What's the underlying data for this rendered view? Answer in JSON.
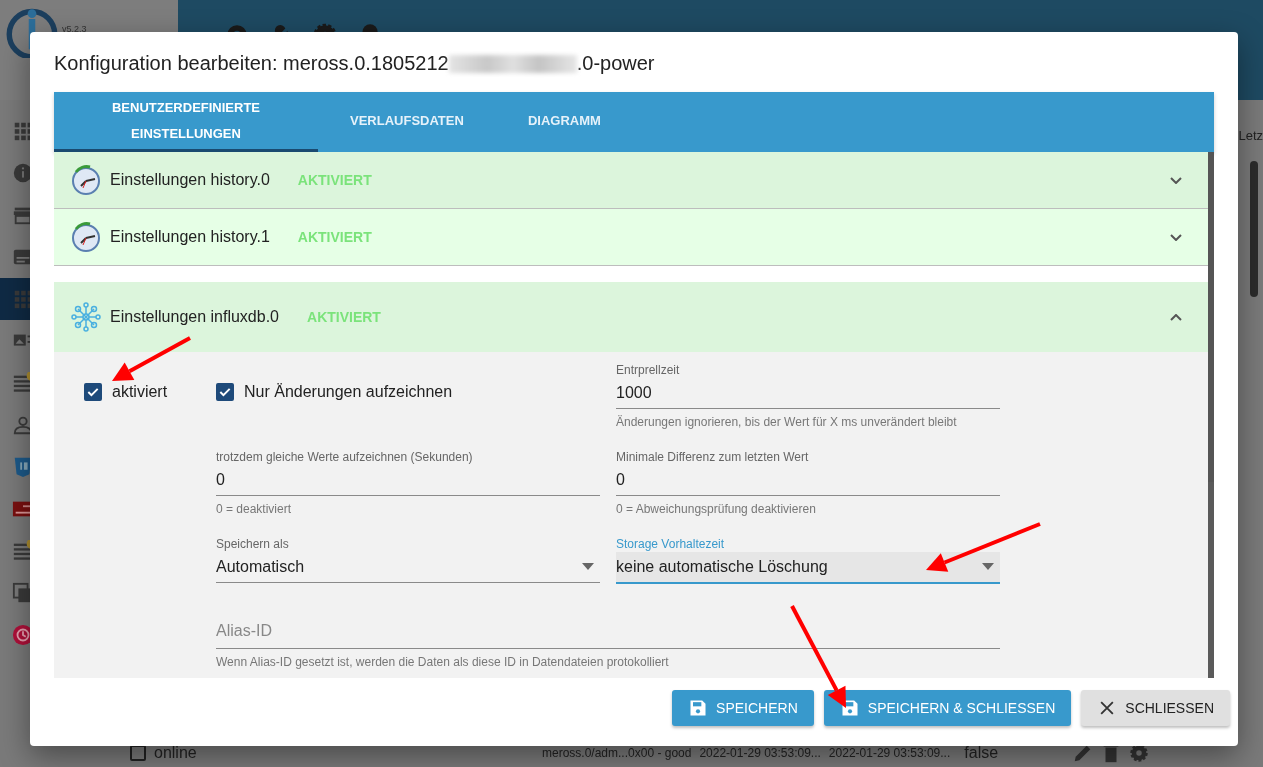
{
  "app": {
    "version": "v5.2.3",
    "header_text": "Letz",
    "sidebar": [
      {
        "kind": "grid",
        "selected": false
      },
      {
        "kind": "info",
        "selected": false
      },
      {
        "kind": "store",
        "selected": false
      },
      {
        "kind": "card",
        "selected": false
      },
      {
        "kind": "grid",
        "selected": true
      },
      {
        "kind": "image",
        "selected": false
      },
      {
        "kind": "list",
        "selected": false
      },
      {
        "kind": "person",
        "selected": false
      },
      {
        "kind": "js",
        "selected": false
      },
      {
        "kind": "badge",
        "selected": false
      },
      {
        "kind": "list",
        "selected": false
      },
      {
        "kind": "copy",
        "selected": false
      },
      {
        "kind": "history",
        "selected": false
      }
    ],
    "row": {
      "checked": false,
      "name": "online",
      "cells": [
        "meross.0/adm...0x00 - good",
        "2022-01-29 03:53:09...",
        "2022-01-29 03:53:09..."
      ],
      "value": "false"
    }
  },
  "dialog": {
    "title_prefix": "Konfiguration bearbeiten: meross.0.1805212",
    "title_suffix": ".0-power",
    "tabs": [
      {
        "label": "BENUTZERDEFINIERTE EINSTELLUNGEN",
        "selected": true
      },
      {
        "label": "VERLAUFSDATEN",
        "selected": false
      },
      {
        "label": "DIAGRAMM",
        "selected": false
      }
    ],
    "panels": [
      {
        "kind": "history",
        "title": "Einstellungen history.0",
        "status": "AKTIVIERT",
        "expanded": false
      },
      {
        "kind": "history",
        "title": "Einstellungen history.1",
        "status": "AKTIVIERT",
        "expanded": false
      },
      {
        "kind": "influxdb",
        "title": "Einstellungen influxdb.0",
        "status": "AKTIVIERT",
        "expanded": true
      }
    ],
    "form": {
      "checkboxes": [
        {
          "label": "aktiviert",
          "checked": true
        },
        {
          "label": "Nur Änderungen aufzeichnen",
          "checked": true
        }
      ],
      "fields": [
        {
          "kind": "text",
          "label": "Entrprellzeit",
          "value": "1000",
          "helper": "Änderungen ignorieren, bis der Wert für X ms unverändert bleibt",
          "focused": false
        },
        {
          "kind": "text",
          "label": "trotzdem gleiche Werte aufzeichnen (Sekunden)",
          "value": "0",
          "helper": "0 = deaktiviert",
          "focused": false
        },
        {
          "kind": "text",
          "label": "Minimale Differenz zum letzten Wert",
          "value": "0",
          "helper": "0 = Abweichungsprüfung deaktivieren",
          "focused": false
        },
        {
          "kind": "select",
          "label": "Speichern als",
          "value": "Automatisch",
          "focused": false
        },
        {
          "kind": "select",
          "label": "Storage Vorhaltezeit",
          "value": "keine automatische Löschung",
          "focused": true
        }
      ],
      "alias": {
        "placeholder": "Alias-ID",
        "helper": "Wenn Alias-ID gesetzt ist, werden die Daten als diese ID in Datendateien protokolliert"
      }
    },
    "buttons": [
      {
        "kind": "primary",
        "label": "SPEICHERN"
      },
      {
        "kind": "primary",
        "label": "SPEICHERN & SCHLIESSEN"
      },
      {
        "kind": "secondary",
        "label": "SCHLIESSEN"
      }
    ]
  }
}
